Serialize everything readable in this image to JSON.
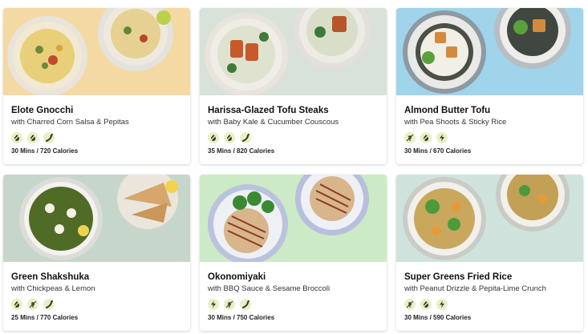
{
  "recipes": [
    {
      "title": "Elote Gnocchi",
      "subtitle": "with Charred Corn Salsa & Pepitas",
      "meta": "30 Mins / 720 Calories",
      "tags": [
        "flame-off-icon",
        "flame-off-icon",
        "chili-icon"
      ],
      "bg": "#f4d9a3",
      "plates": "two-plates-corn"
    },
    {
      "title": "Harissa-Glazed Tofu Steaks",
      "subtitle": "with Baby Kale & Cucumber Couscous",
      "meta": "35 Mins / 820 Calories",
      "tags": [
        "flame-off-icon",
        "flame-off-icon",
        "chili-icon"
      ],
      "bg": "#d8e2d9",
      "plates": "two-plates-tofu"
    },
    {
      "title": "Almond Butter Tofu",
      "subtitle": "with Pea Shoots & Sticky Rice",
      "meta": "30 Mins / 670 Calories",
      "tags": [
        "gluten-free-icon",
        "flame-off-icon",
        "lightning-icon"
      ],
      "bg": "#9fd4ea",
      "plates": "two-plates-almond"
    },
    {
      "title": "Green Shakshuka",
      "subtitle": "with Chickpeas & Lemon",
      "meta": "25 Mins / 770 Calories",
      "tags": [
        "flame-off-icon",
        "gluten-free-icon",
        "chili-icon"
      ],
      "bg": "#c7d6cb",
      "plates": "pan-shakshuka"
    },
    {
      "title": "Okonomiyaki",
      "subtitle": "with BBQ Sauce & Sesame Broccoli",
      "meta": "30 Mins / 750 Calories",
      "tags": [
        "lightning-icon",
        "gluten-free-icon",
        "chili-icon"
      ],
      "bg": "#cdeac6",
      "plates": "two-plates-okonomiyaki"
    },
    {
      "title": "Super Greens Fried Rice",
      "subtitle": "with Peanut Drizzle & Pepita-Lime Crunch",
      "meta": "30 Mins / 590 Calories",
      "tags": [
        "gluten-free-icon",
        "flame-off-icon",
        "lightning-icon"
      ],
      "bg": "#cfe3dc",
      "plates": "two-plates-friedrice"
    }
  ],
  "colors": {
    "tag_bg": "#e7f0c6",
    "tag_fg": "#2f3b1c"
  }
}
